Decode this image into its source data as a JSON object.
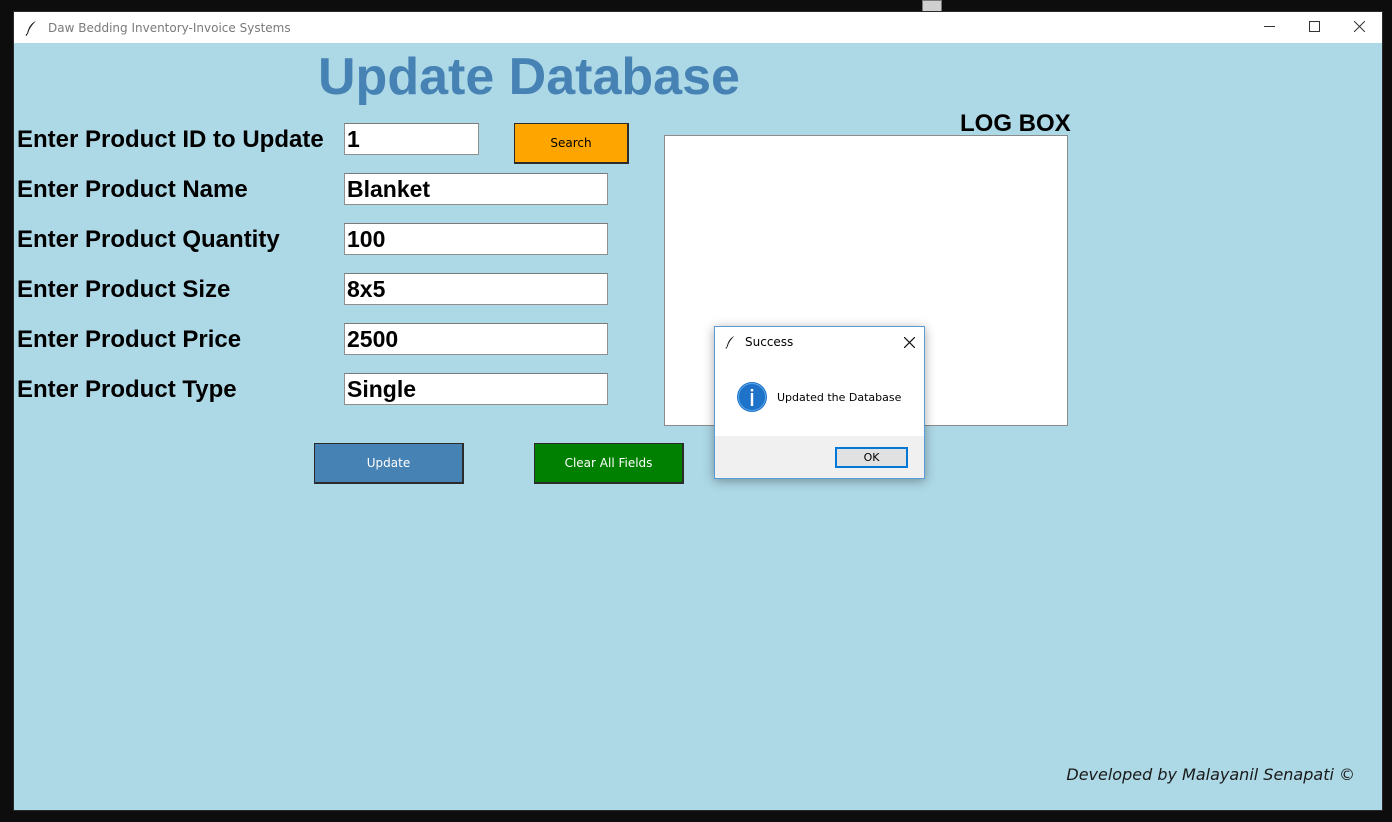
{
  "window": {
    "title": "Daw Bedding Inventory-Invoice Systems",
    "controls": [
      "minimize",
      "maximize",
      "close"
    ]
  },
  "page": {
    "heading": "Update Database",
    "fields": [
      {
        "label": "Enter Product ID to Update",
        "value": "1"
      },
      {
        "label": "Enter Product Name",
        "value": "Blanket"
      },
      {
        "label": "Enter Product Quantity",
        "value": "100"
      },
      {
        "label": "Enter Product Size",
        "value": "8x5"
      },
      {
        "label": "Enter Product Price",
        "value": "2500"
      },
      {
        "label": "Enter Product Type",
        "value": "Single"
      }
    ],
    "search_button": "Search",
    "update_button": "Update",
    "clear_button": "Clear All Fields",
    "log_title": "LOG BOX",
    "log_content": "",
    "footer": "Developed by Malayanil Senapati ©"
  },
  "dialog": {
    "title": "Success",
    "message": "Updated the Database",
    "ok_label": "OK"
  },
  "colors": {
    "background": "#add8e6",
    "heading": "#4682b4",
    "search_button": "#ffa500",
    "update_button": "#4682b4",
    "clear_button": "#008000"
  },
  "icons": [
    "feather-icon",
    "minimize-icon",
    "maximize-icon",
    "close-icon",
    "info-icon"
  ]
}
